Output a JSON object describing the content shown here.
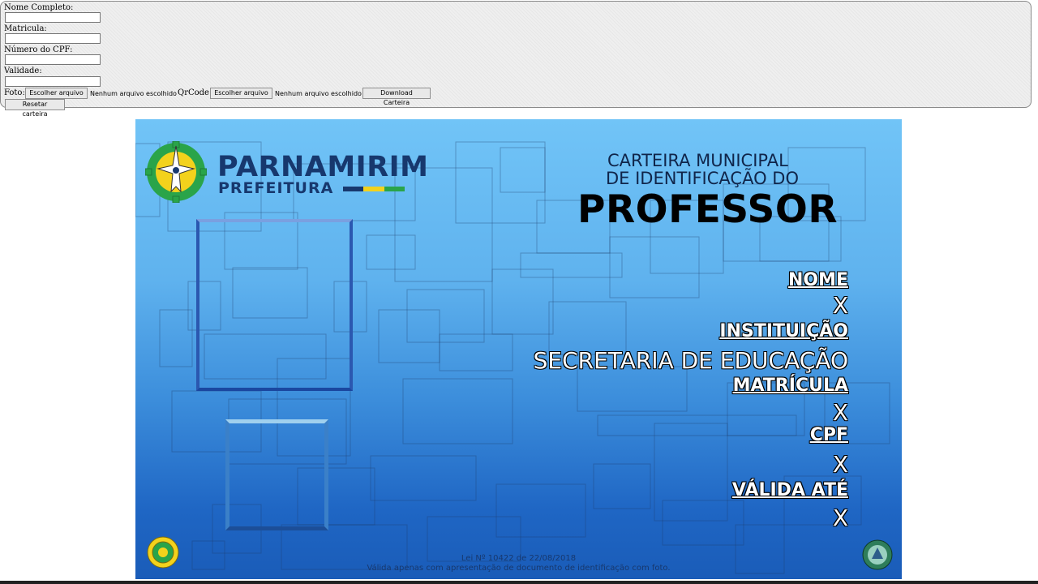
{
  "form": {
    "nome_label": "Nome Completo:",
    "nome_value": "",
    "matricula_label": "Matricula:",
    "matricula_value": "",
    "cpf_label": "Número do CPF:",
    "cpf_value": "",
    "validade_label": "Validade:",
    "validade_value": "",
    "foto_label": "Foto:",
    "foto_button": "Escolher arquivo",
    "foto_status": "Nenhum arquivo escolhido",
    "qrcode_label": "QrCode:",
    "qrcode_button": "Escolher arquivo",
    "qrcode_status": "Nenhum arquivo escolhido",
    "download_button": "Download Carteira",
    "reset_button": "Resetar carteira"
  },
  "card": {
    "logo_name": "PARNAMIRIM",
    "logo_sub": "PREFEITURA",
    "title_line1": "CARTEIRA MUNICIPAL",
    "title_line2": "DE IDENTIFICAÇÃO DO",
    "title_main": "PROFESSOR",
    "fields": {
      "nome_label": "NOME",
      "nome_value": "X",
      "instituicao_label": "INSTITUIÇÃO",
      "instituicao_value": "SECRETARIA DE EDUCAÇÃO",
      "matricula_label": "MATRÍCULA",
      "matricula_value": "X",
      "cpf_label": "CPF",
      "cpf_value": "X",
      "validade_label": "VÁLIDA ATÉ",
      "validade_value": "X"
    },
    "footer_law": "Lei Nº 10422 de 22/08/2018",
    "footer_note": "Válida apenas com apresentação de documento de identificação com foto.",
    "colors": {
      "brand_navy": "#17386e",
      "flag_green": "#2aa44a",
      "flag_yellow": "#f3d21c",
      "flag_navy": "#17386e"
    }
  }
}
